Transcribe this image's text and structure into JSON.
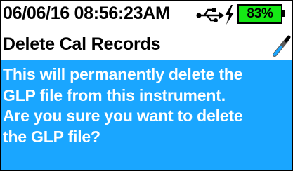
{
  "status_bar": {
    "datetime": "06/06/16  08:56:23AM",
    "usb_icon": "usb-icon",
    "charging_icon": "lightning-bolt-icon",
    "battery": {
      "label": "83%",
      "level_percent": 83,
      "color": "#15e815"
    }
  },
  "header": {
    "title": "Delete Cal Records",
    "icon": "pen-icon"
  },
  "message": {
    "background": "#1aa6ff",
    "lines": [
      "This will permanently delete the",
      "GLP file from this instrument.",
      "Are you sure you want to delete",
      "the GLP file?"
    ]
  }
}
